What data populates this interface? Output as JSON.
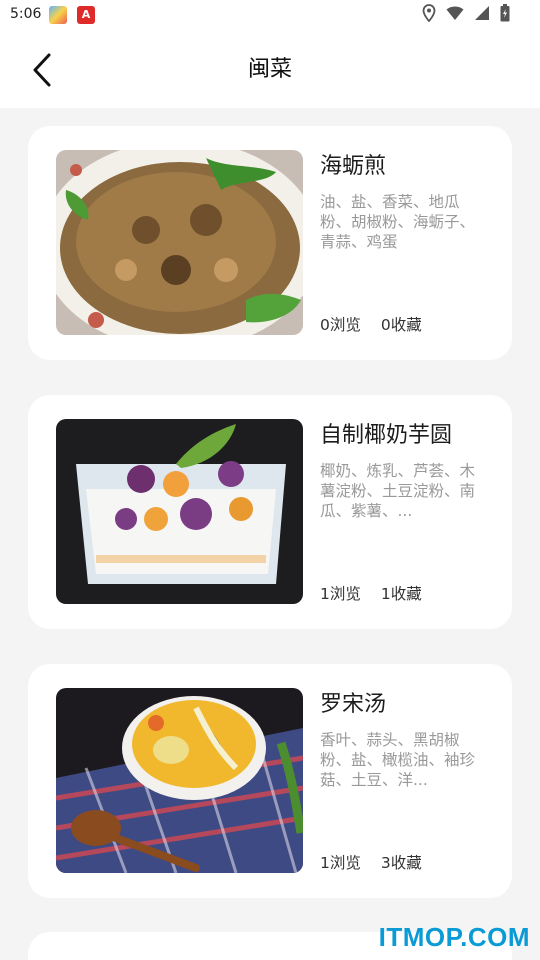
{
  "status_bar": {
    "time": "5:06",
    "app_icon_2_label": "A"
  },
  "header": {
    "title": "闽菜"
  },
  "recipes": [
    {
      "name": "海蛎煎",
      "ingredients": "油、盐、香菜、地瓜粉、胡椒粉、海蛎子、青蒜、鸡蛋",
      "views": "0浏览",
      "favorites": "0收藏"
    },
    {
      "name": "自制椰奶芋圆",
      "ingredients": "椰奶、炼乳、芦荟、木薯淀粉、土豆淀粉、南瓜、紫薯、...",
      "views": "1浏览",
      "favorites": "1收藏"
    },
    {
      "name": "罗宋汤",
      "ingredients": "香叶、蒜头、黑胡椒粉、盐、橄榄油、袖珍菇、土豆、洋...",
      "views": "1浏览",
      "favorites": "3收藏"
    }
  ],
  "watermark": "ITMOP.COM",
  "icons": {
    "back": "back-arrow-icon",
    "location": "location-icon",
    "wifi": "wifi-icon",
    "signal": "signal-icon",
    "battery": "battery-icon"
  }
}
